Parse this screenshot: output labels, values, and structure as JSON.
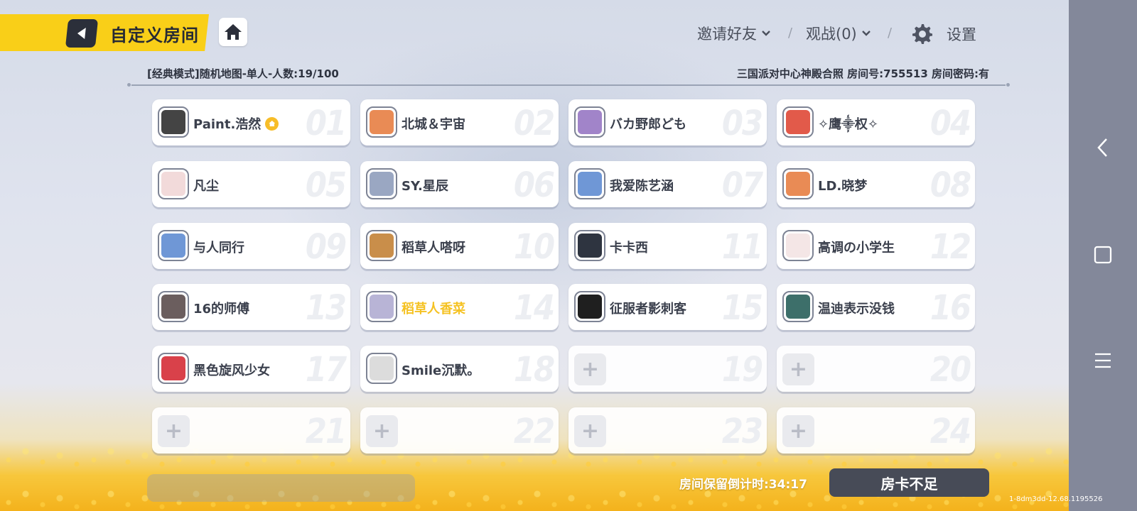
{
  "header": {
    "title": "自定义房间",
    "invite_label": "邀请好友",
    "spectate_label": "观战(0)",
    "settings_label": "设置",
    "separator": "/"
  },
  "room": {
    "mode_info": "[经典模式]随机地图-单人-人数:19/100",
    "room_info": "三国派对中心神殿合照 房间号:755513 房间密码:有"
  },
  "slots": [
    {
      "num": "01",
      "name": "Paint.浩然",
      "host": true,
      "avatar_color": "#444"
    },
    {
      "num": "02",
      "name": "北城＆宇宙",
      "avatar_color": "#e98b55"
    },
    {
      "num": "03",
      "name": "バカ野郎ども",
      "avatar_color": "#a184c9"
    },
    {
      "num": "04",
      "name": "✧鹰⸎权✧",
      "avatar_color": "#e25a4a"
    },
    {
      "num": "05",
      "name": "凡尘",
      "avatar_color": "#f2dada"
    },
    {
      "num": "06",
      "name": "SY.星辰",
      "avatar_color": "#9aa7c2"
    },
    {
      "num": "07",
      "name": "我爱陈艺涵",
      "avatar_color": "#6f97d6"
    },
    {
      "num": "08",
      "name": "LD.晓梦",
      "avatar_color": "#e98b55"
    },
    {
      "num": "09",
      "name": "与人同行",
      "avatar_color": "#6f97d6"
    },
    {
      "num": "10",
      "name": "稻草人嗒呀",
      "avatar_color": "#c98e4a"
    },
    {
      "num": "11",
      "name": "卡卡西",
      "avatar_color": "#2e3440"
    },
    {
      "num": "12",
      "name": "高调の小学生",
      "avatar_color": "#f4e6e6"
    },
    {
      "num": "13",
      "name": "16的师傅",
      "avatar_color": "#6b5e5e"
    },
    {
      "num": "14",
      "name": "稻草人香菜",
      "highlight": true,
      "avatar_color": "#b8b4d6"
    },
    {
      "num": "15",
      "name": "征服者影刺客",
      "avatar_color": "#1f1f1f"
    },
    {
      "num": "16",
      "name": "温迪表示没钱",
      "avatar_color": "#3d6f6a"
    },
    {
      "num": "17",
      "name": "黑色旋风少女",
      "avatar_color": "#d9414a"
    },
    {
      "num": "18",
      "name": "Smile沉默。",
      "avatar_color": "#dcdcdc"
    },
    {
      "num": "19",
      "empty": true
    },
    {
      "num": "20",
      "empty": true
    },
    {
      "num": "21",
      "empty": true
    },
    {
      "num": "22",
      "empty": true
    },
    {
      "num": "23",
      "empty": true
    },
    {
      "num": "24",
      "empty": true
    }
  ],
  "slot_plus": "+",
  "footer": {
    "countdown": "房间保留倒计时:34:17",
    "room_card_button": "房卡不足",
    "version": "1-8dm3dd-12.68.1195526"
  },
  "colors": {
    "accent_yellow": "#f9cf18",
    "highlight_name": "#f5c222",
    "dark_button": "#474b57"
  }
}
